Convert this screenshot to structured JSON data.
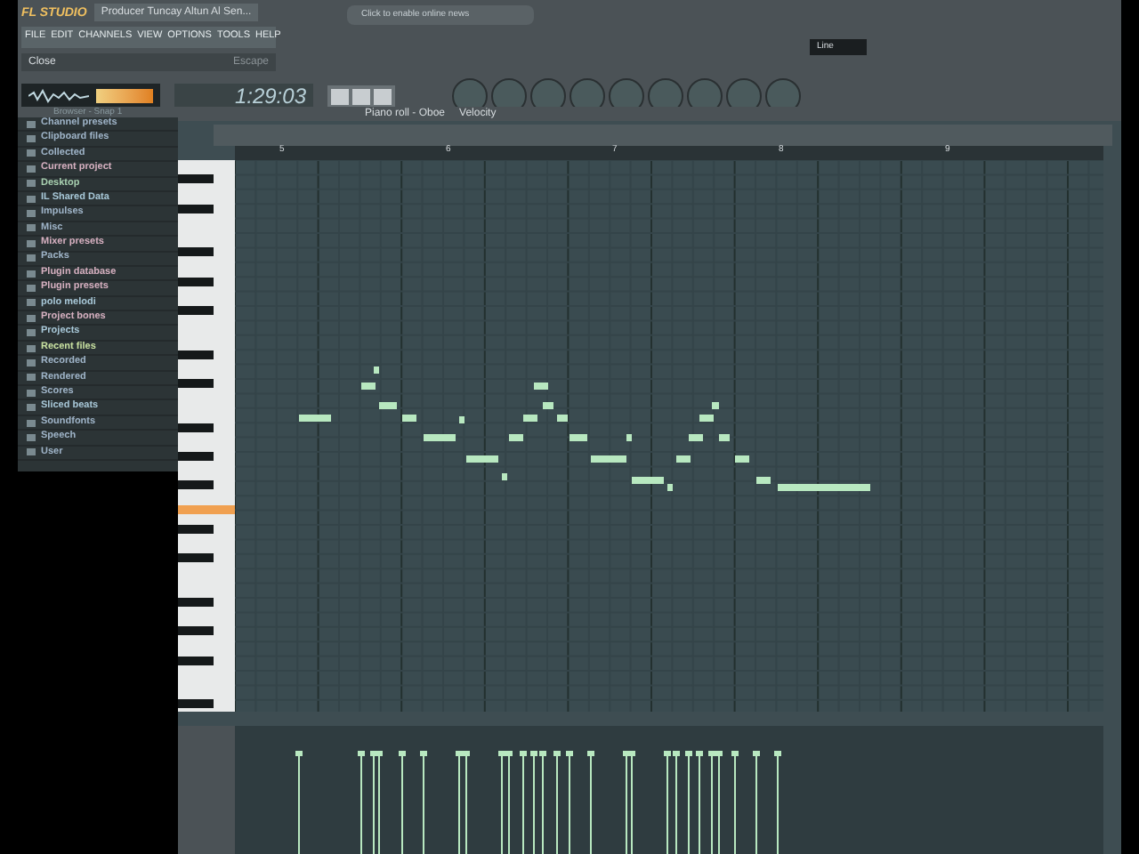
{
  "window": {
    "logo": "FL STUDIO",
    "title": "Producer Tuncay Altun Al Sen..."
  },
  "menu": [
    "FILE",
    "EDIT",
    "CHANNELS",
    "VIEW",
    "OPTIONS",
    "TOOLS",
    "HELP"
  ],
  "hint": {
    "text": "Close",
    "shortcut": "Escape"
  },
  "news": {
    "text": "Click to enable online news"
  },
  "clock": "1:29:03",
  "snap_select": "Line",
  "browser": {
    "title": "Browser - Snap 1",
    "items": [
      {
        "label": "Channel presets",
        "color": "#9fb4c8"
      },
      {
        "label": "Clipboard files",
        "color": "#9fb4c8"
      },
      {
        "label": "Collected",
        "color": "#9fb4c8"
      },
      {
        "label": "Current project",
        "color": "#d6b0c0"
      },
      {
        "label": "Desktop",
        "color": "#a8d0b0"
      },
      {
        "label": "IL Shared Data",
        "color": "#a8c8d8"
      },
      {
        "label": "Impulses",
        "color": "#9fb4c8"
      },
      {
        "label": "Misc",
        "color": "#9fb4c8"
      },
      {
        "label": "Mixer presets",
        "color": "#d6b0c0"
      },
      {
        "label": "Packs",
        "color": "#9fb4c8"
      },
      {
        "label": "Plugin database",
        "color": "#d6b0c0"
      },
      {
        "label": "Plugin presets",
        "color": "#d6b0c0"
      },
      {
        "label": "polo melodi",
        "color": "#a8c8d8"
      },
      {
        "label": "Project bones",
        "color": "#d6b0c0"
      },
      {
        "label": "Projects",
        "color": "#a8c8d8"
      },
      {
        "label": "Recent files",
        "color": "#c8e0a0"
      },
      {
        "label": "Recorded",
        "color": "#9fb4c8"
      },
      {
        "label": "Rendered",
        "color": "#9fb4c8"
      },
      {
        "label": "Scores",
        "color": "#9fb4c8"
      },
      {
        "label": "Sliced beats",
        "color": "#a8c8d8"
      },
      {
        "label": "Soundfonts",
        "color": "#9fb4c8"
      },
      {
        "label": "Speech",
        "color": "#9fb4c8"
      },
      {
        "label": "User",
        "color": "#9fb4c8"
      }
    ]
  },
  "piano_roll": {
    "title": "Piano roll - Oboe",
    "target": "Velocity",
    "ruler": [
      "5",
      "6",
      "7",
      "8",
      "9"
    ]
  }
}
